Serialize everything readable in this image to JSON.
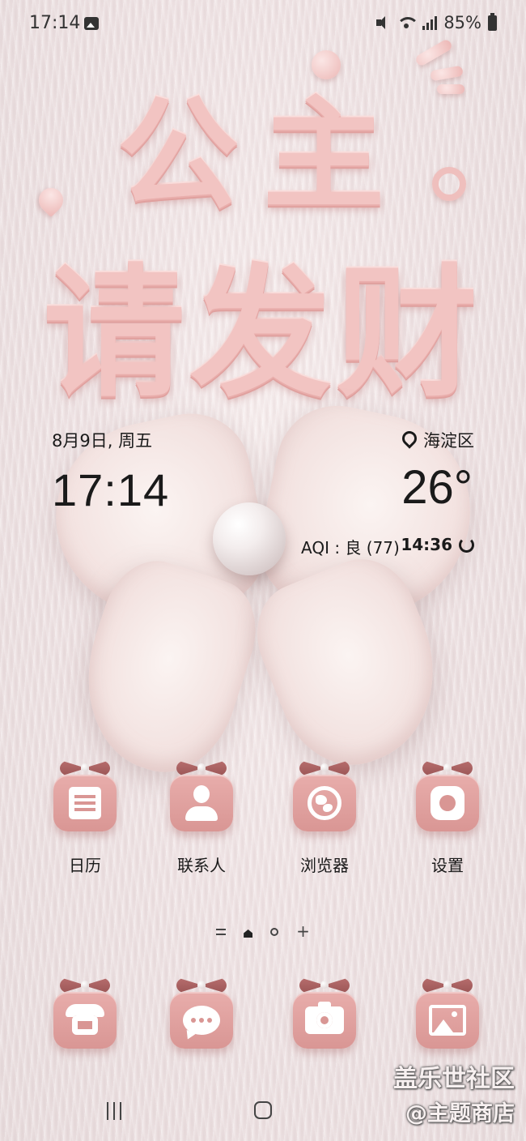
{
  "status_bar": {
    "time": "17:14",
    "battery": "85%",
    "icons": [
      "gallery-icon",
      "mute-icon",
      "wifi-icon",
      "signal-icon",
      "battery-icon"
    ]
  },
  "wallpaper": {
    "line1": "公主",
    "line2": "请发财",
    "colors": {
      "accent": "#f2c4c2",
      "background": "#efe3e4"
    }
  },
  "widget": {
    "date": "8月9日, 周五",
    "time": "17:14",
    "location": "海淀区",
    "temperature": "26°",
    "aqi": "AQI : 良 (77)",
    "updated": "14:36"
  },
  "apps": [
    {
      "label": "日历",
      "icon": "calendar-icon"
    },
    {
      "label": "联系人",
      "icon": "contacts-icon"
    },
    {
      "label": "浏览器",
      "icon": "browser-icon"
    },
    {
      "label": "设置",
      "icon": "settings-icon"
    }
  ],
  "dock": [
    {
      "icon": "phone-icon"
    },
    {
      "icon": "messages-icon"
    },
    {
      "icon": "camera-icon"
    },
    {
      "icon": "gallery-icon"
    }
  ],
  "page_indicator": {
    "plus": "+"
  },
  "watermark": {
    "line1": "盖乐世社区",
    "line2": "@主题商店"
  },
  "icon_color": "#d99694",
  "bow_color": "#9b5656"
}
